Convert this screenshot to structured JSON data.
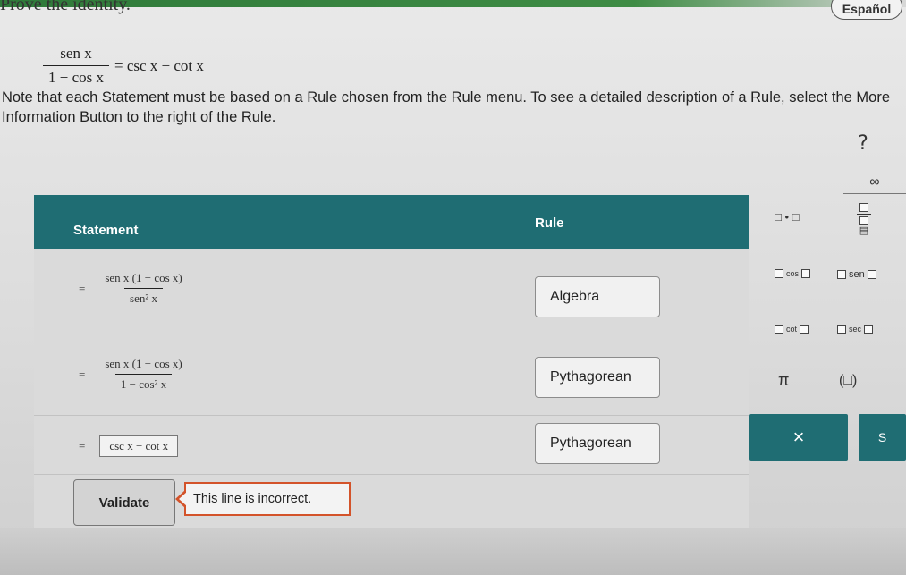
{
  "header": {
    "top_text": "Prove the identity.",
    "language_button": "Español"
  },
  "identity": {
    "lhs_numerator": "sen x",
    "lhs_denominator": "1 + cos x",
    "rhs": "= csc x − cot x"
  },
  "instructions": {
    "note": "Note that each Statement must be based on a Rule chosen from the Rule menu. To see a detailed description of a Rule, select the More Information Button to the right of the Rule.",
    "help_label": "?"
  },
  "table": {
    "columns": [
      "Statement",
      "Rule"
    ],
    "rows": [
      {
        "eq": "=",
        "numerator": "sen x (1 − cos x)",
        "denominator": "sen² x",
        "rule": "Algebra"
      },
      {
        "eq": "=",
        "numerator": "sen x (1 − cos x)",
        "denominator": "1 − cos² x",
        "rule": "Pythagorean"
      },
      {
        "eq": "=",
        "answer": "csc x − cot x",
        "rule": "Pythagorean"
      }
    ]
  },
  "validate": {
    "button_label": "Validate",
    "feedback": "This line is incorrect."
  },
  "palette": {
    "tab_label": "∞",
    "items": {
      "dot": "□ • □",
      "cos": "cos",
      "sen": "sen",
      "cot": "cot",
      "sec": "sec",
      "pi": "π",
      "paren": "(□)"
    },
    "clear_label": "×",
    "other_label": "S"
  },
  "colors": {
    "header_teal": "#1f6d73",
    "feedback_border": "#d3532a"
  }
}
